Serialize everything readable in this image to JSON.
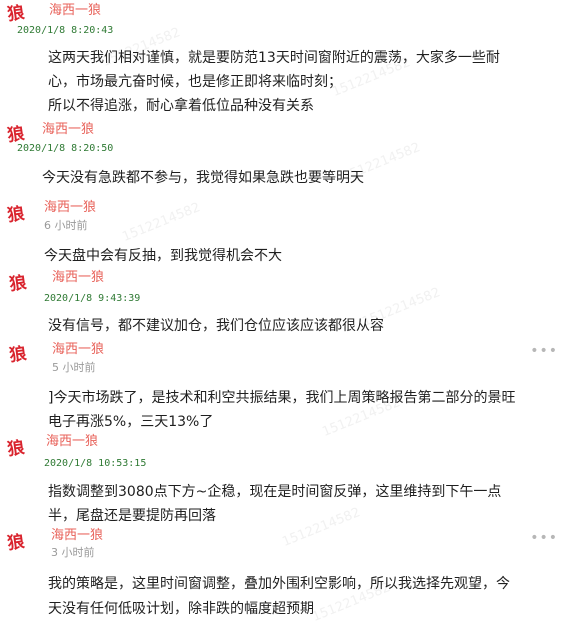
{
  "posts": [
    {
      "author": "海西一狼",
      "time": "2020/1/8 8:20:43",
      "lines": [
        "这两天我们相对谨慎，就是要防范13天时间窗附近的震荡，大家多一些耐",
        "心，市场最亢奋时候，也是修正即将来临时刻；",
        "所以不得追涨，耐心拿着低位品种没有关系"
      ]
    },
    {
      "author": "海西一狼",
      "time": "2020/1/8 8:20:50",
      "lines": [
        "今天没有急跌都不参与，我觉得如果急跌也要等明天"
      ]
    },
    {
      "author": "海西一狼",
      "time": "6 小时前",
      "lines": [
        "今天盘中会有反抽，到我觉得机会不大"
      ]
    },
    {
      "author": "海西一狼",
      "time": "2020/1/8 9:43:39",
      "lines": [
        "没有信号，都不建议加仓，我们仓位应该应该都很从容"
      ]
    },
    {
      "author": "海西一狼",
      "time": "5 小时前",
      "more": "•••",
      "lines": [
        "]今天市场跌了，是技术和利空共振结果，我们上周策略报告第二部分的景旺",
        "电子再涨5%，三天13%了"
      ]
    },
    {
      "author": "海西一狼",
      "time": "2020/1/8 10:53:15",
      "lines": [
        "指数调整到3080点下方~企稳，现在是时间窗反弹，这里维持到下午一点",
        "半，尾盘还是要提防再回落"
      ]
    },
    {
      "author": "海西一狼",
      "time": "3 小时前",
      "more": "•••",
      "lines": [
        "我的策略是，这里时间窗调整，叠加外围利空影响，所以我选择先观望，今",
        "天没有任何低吸计划，除非跌的幅度超预期"
      ]
    }
  ],
  "avatar_glyph": "狼",
  "watermark_text": "1512214582",
  "colors": {
    "author": "#e8625a",
    "timestamp": "#2f7a34",
    "relative_time": "#9a9a9a",
    "avatar": "#d9232d"
  }
}
